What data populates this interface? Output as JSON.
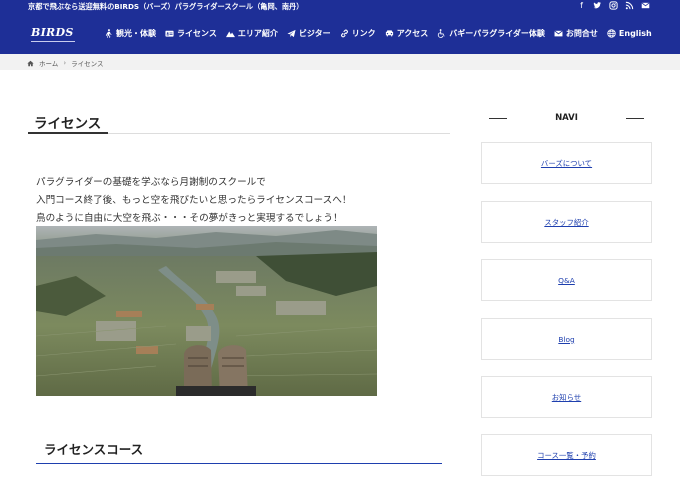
{
  "topbar": {
    "tagline": "京都で飛ぶなら送迎無料のBIRDS（バーズ）パラグライダースクール（亀岡、南丹）",
    "social": [
      {
        "icon": "facebook-icon",
        "glyph": "f"
      },
      {
        "icon": "twitter-icon",
        "glyph": "t"
      },
      {
        "icon": "instagram-icon",
        "glyph": "◎"
      },
      {
        "icon": "rss-icon",
        "glyph": "))"
      },
      {
        "icon": "mail-icon",
        "glyph": "✉"
      }
    ]
  },
  "logo": {
    "text": "BIRDS"
  },
  "nav": [
    {
      "label": "観光・体験",
      "icon": "walking-person-icon"
    },
    {
      "label": "ライセンス",
      "icon": "id-card-icon"
    },
    {
      "label": "エリア紹介",
      "icon": "mountain-icon"
    },
    {
      "label": "ビジター",
      "icon": "paper-plane-icon"
    },
    {
      "label": "リンク",
      "icon": "link-icon"
    },
    {
      "label": "アクセス",
      "icon": "car-icon"
    },
    {
      "label": "バギーパラグライダー体験",
      "icon": "wheelchair-icon"
    },
    {
      "label": "お問合せ",
      "icon": "envelope-icon"
    },
    {
      "label": "English",
      "icon": "globe-icon"
    }
  ],
  "breadcrumb": {
    "home": "ホーム",
    "current": "ライセンス"
  },
  "main": {
    "title": "ライセンス",
    "intro": [
      "パラグライダーの基礎を学ぶなら月謝制のスクールで",
      "入門コース終了後、もっと空を飛びたいと思ったらライセンスコースへ！",
      "鳥のように自由に大空を飛ぶ・・・その夢がきっと実現するでしょう！"
    ],
    "section_title": "ライセンスコース"
  },
  "sidebar": {
    "heading": "NAVI",
    "links": [
      "バーズについて",
      "スタッフ紹介",
      "Q&A",
      "Blog",
      "お知らせ",
      "コース一覧・予約"
    ]
  },
  "colors": {
    "brand": "#1e2f97",
    "link": "#1e3fae"
  }
}
